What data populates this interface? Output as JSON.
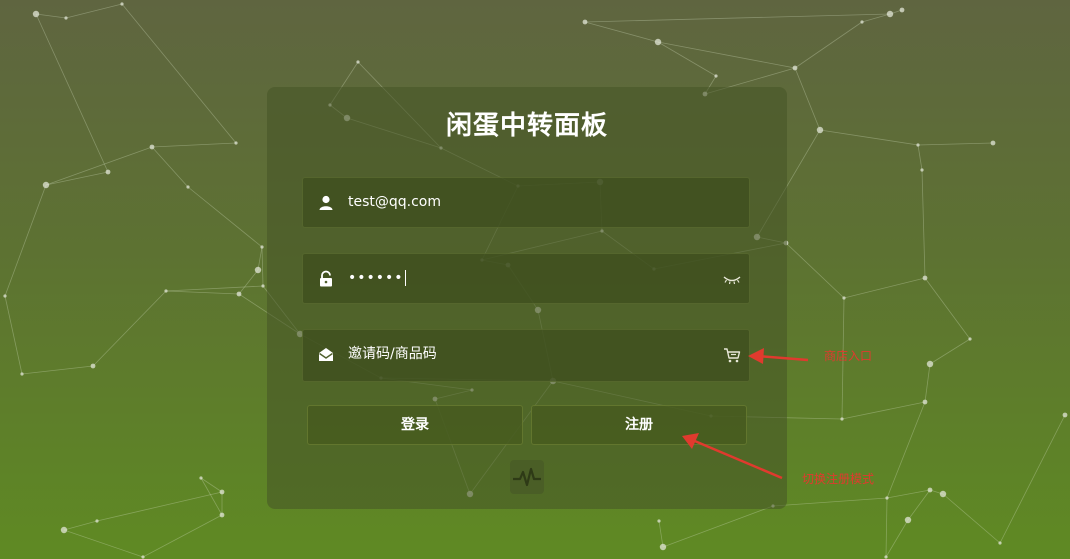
{
  "app": {
    "title": "闲蛋中转面板"
  },
  "form": {
    "email": {
      "value": "test@qq.com"
    },
    "password": {
      "value": "••••••"
    },
    "invite": {
      "placeholder": "邀请码/商品码"
    }
  },
  "buttons": {
    "login": "登录",
    "register": "注册"
  },
  "annotations": {
    "shop_entry": "商店入口",
    "switch_mode": "切换注册模式"
  },
  "colors": {
    "accent_annotation": "#e03a2e",
    "panel": "#4f5f2c",
    "text": "#ffffff"
  },
  "icons": [
    "user-icon",
    "lock-icon",
    "eye-closed-icon",
    "envelope-icon",
    "cart-icon",
    "pulse-logo-icon"
  ]
}
